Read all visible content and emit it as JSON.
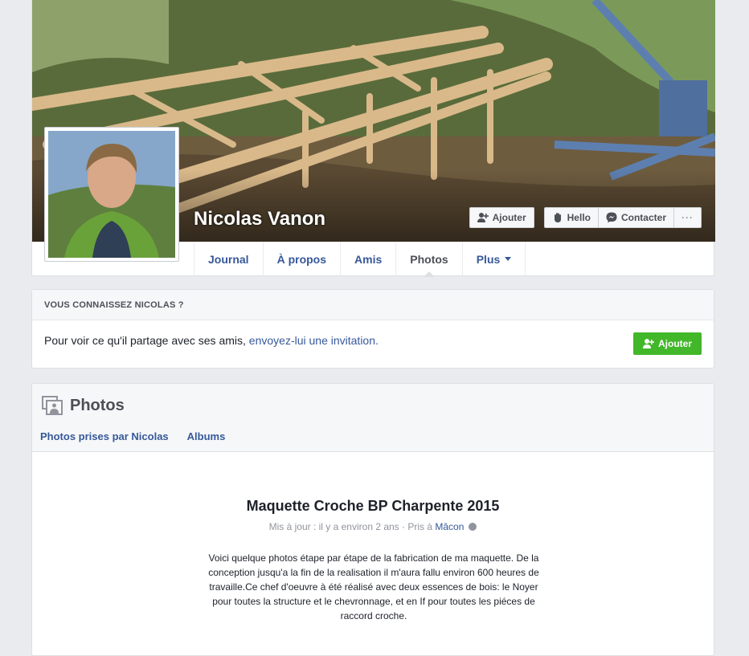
{
  "profile": {
    "name": "Nicolas Vanon"
  },
  "cover_actions": {
    "add_friend": "Ajouter",
    "wave": "Hello",
    "message": "Contacter",
    "more": "···"
  },
  "tabs": [
    {
      "label": "Journal"
    },
    {
      "label": "À propos"
    },
    {
      "label": "Amis"
    },
    {
      "label": "Photos",
      "active": true
    },
    {
      "label": "Plus"
    }
  ],
  "know_card": {
    "heading": "VOUS CONNAISSEZ NICOLAS ?",
    "text": "Pour voir ce qu'il partage avec ses amis, ",
    "link": "envoyez-lui une invitation.",
    "button": "Ajouter"
  },
  "photos": {
    "title": "Photos",
    "tabs": [
      "Photos prises par Nicolas",
      "Albums"
    ],
    "album": {
      "title": "Maquette Croche BP Charpente 2015",
      "meta_prefix": "Mis à jour : il y a environ 2 ans · Pris à ",
      "meta_place": "Mâcon",
      "description": "Voici quelque photos étape par étape de la fabrication de ma maquette. De la conception jusqu'a la fin de la realisation il m'aura fallu environ 600 heures de travaille.Ce chef d'oeuvre à été réalisé avec deux essences de bois: le Noyer pour toutes la structure et le chevronnage, et en If pour toutes les piéces de raccord croche."
    }
  },
  "colors": {
    "link": "#365899",
    "green": "#42b72a",
    "background": "#e9ebee"
  }
}
